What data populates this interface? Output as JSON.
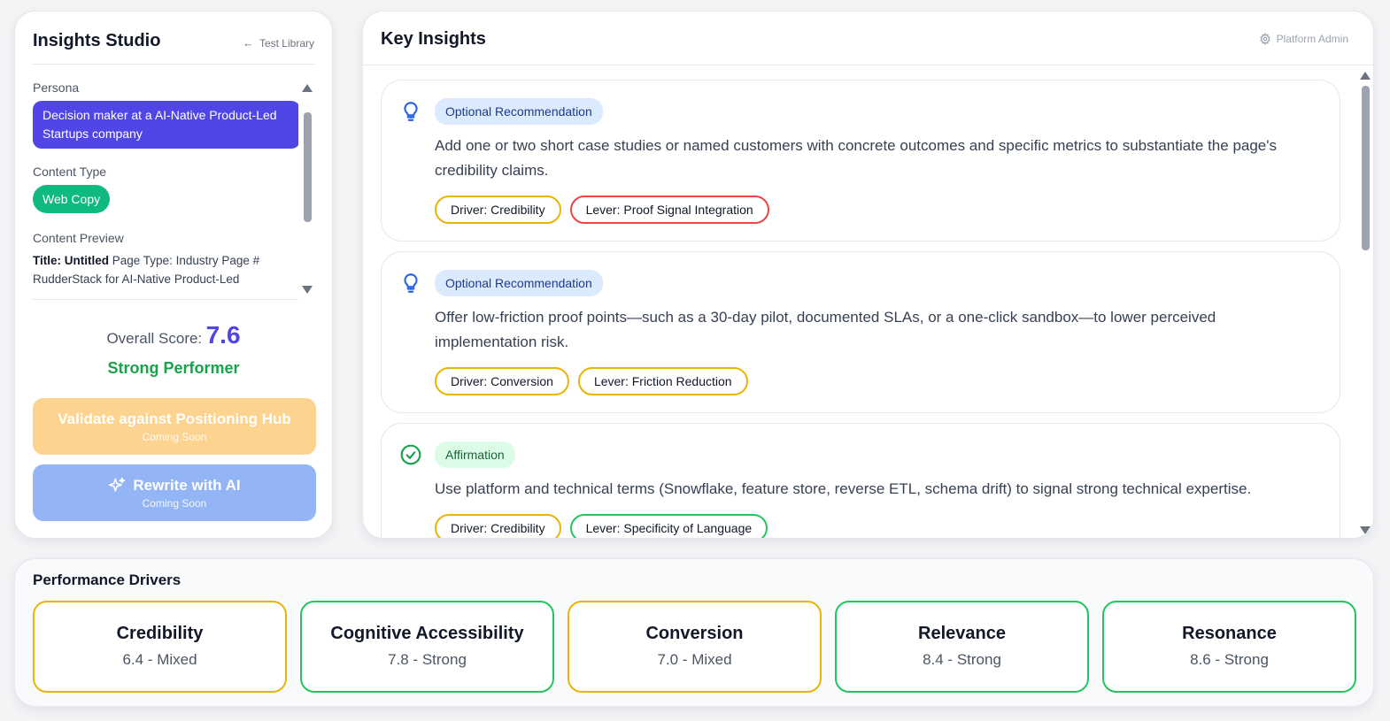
{
  "sidebar": {
    "title": "Insights Studio",
    "back_link": "Test Library",
    "persona_label": "Persona",
    "persona_value": "Decision maker at a AI-Native Product-Led Startups company",
    "content_type_label": "Content Type",
    "content_type_value": "Web Copy",
    "preview_label": "Content Preview",
    "preview_title_key": "Title: Untitled",
    "preview_text": "Page Type: Industry Page # RudderStack for AI-Native Product-Led",
    "score_label": "Overall Score:",
    "score_value": "7.6",
    "score_tier": "Strong Performer",
    "validate_button": "Validate against Positioning Hub",
    "validate_sub": "Coming Soon",
    "rewrite_button": "Rewrite with AI",
    "rewrite_sub": "Coming Soon"
  },
  "insights": {
    "title": "Key Insights",
    "admin_link": "Platform Admin",
    "items": [
      {
        "type": "Optional Recommendation",
        "icon": "lightbulb-icon",
        "text": "Add one or two short case studies or named customers with concrete outcomes and specific metrics to substantiate the page's credibility claims.",
        "driver_tag": "Driver: Credibility",
        "lever_tag": "Lever: Proof Signal Integration"
      },
      {
        "type": "Optional Recommendation",
        "icon": "lightbulb-icon",
        "text": "Offer low-friction proof points—such as a 30-day pilot, documented SLAs, or a one-click sandbox—to lower perceived implementation risk.",
        "driver_tag": "Driver: Conversion",
        "lever_tag": "Lever: Friction Reduction"
      },
      {
        "type": "Affirmation",
        "icon": "check-circle-icon",
        "text": "Use platform and technical terms (Snowflake, feature store, reverse ETL, schema drift) to signal strong technical expertise.",
        "driver_tag": "Driver: Credibility",
        "lever_tag": "Lever: Specificity of Language"
      }
    ]
  },
  "drivers": {
    "title": "Performance Drivers",
    "items": [
      {
        "name": "Credibility",
        "score": "6.4 - Mixed"
      },
      {
        "name": "Cognitive Accessibility",
        "score": "7.8 - Strong"
      },
      {
        "name": "Conversion",
        "score": "7.0 - Mixed"
      },
      {
        "name": "Relevance",
        "score": "8.4 - Strong"
      },
      {
        "name": "Resonance",
        "score": "8.6 - Strong"
      }
    ]
  },
  "colors": {
    "accent": "#4f46e5",
    "success": "#10b981",
    "mixed": "#eab308",
    "strong": "#22c55e",
    "risk": "#ef4444"
  }
}
